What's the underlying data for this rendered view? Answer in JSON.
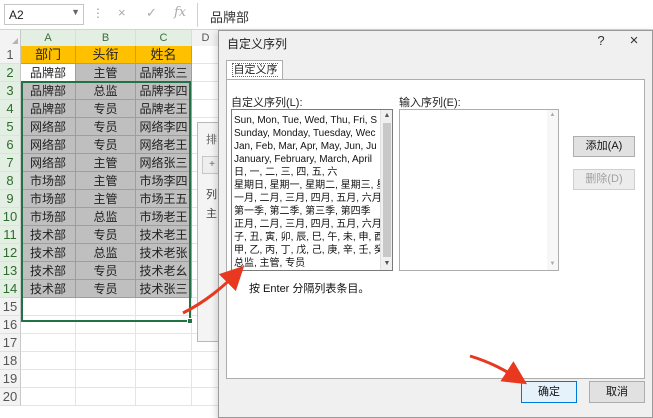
{
  "formula_bar": {
    "name_box": "A2",
    "cancel_icon": "×",
    "confirm_icon": "✓",
    "function_icon": "fx",
    "value": "品牌部"
  },
  "sheet": {
    "columns": [
      "A",
      "B",
      "C",
      "D"
    ],
    "rows": [
      "1",
      "2",
      "3",
      "4",
      "5",
      "6",
      "7",
      "8",
      "9",
      "10",
      "11",
      "12",
      "13",
      "14",
      "15",
      "16",
      "17",
      "18",
      "19",
      "20"
    ],
    "header_row": [
      "部门",
      "头衔",
      "姓名"
    ],
    "data": [
      [
        "品牌部",
        "主管",
        "品牌张三"
      ],
      [
        "品牌部",
        "总监",
        "品牌李四"
      ],
      [
        "品牌部",
        "专员",
        "品牌老王"
      ],
      [
        "网络部",
        "专员",
        "网络李四"
      ],
      [
        "网络部",
        "专员",
        "网络老王"
      ],
      [
        "网络部",
        "主管",
        "网络张三"
      ],
      [
        "市场部",
        "主管",
        "市场李四"
      ],
      [
        "市场部",
        "主管",
        "市场王五"
      ],
      [
        "市场部",
        "总监",
        "市场老王"
      ],
      [
        "技术部",
        "专员",
        "技术老王"
      ],
      [
        "技术部",
        "总监",
        "技术老张"
      ],
      [
        "技术部",
        "专员",
        "技术老幺"
      ],
      [
        "技术部",
        "专员",
        "技术张三"
      ]
    ],
    "header_color": "#ffc000",
    "body_color": "#bfbfbf",
    "selection_color": "#217346"
  },
  "sort_dialog": {
    "title": "排",
    "button": "+",
    "column_label": "列",
    "value_label": "主"
  },
  "dialog": {
    "title": "自定义序列",
    "help": "?",
    "close": "×",
    "tab": "自定义序列",
    "lists_label": "自定义序列(L):",
    "entries_label": "输入序列(E):",
    "lists": [
      "Sun, Mon, Tue, Wed, Thu, Fri, S",
      "Sunday, Monday, Tuesday, Wec",
      "Jan, Feb, Mar, Apr, May, Jun, Ju",
      "January, February, March, April",
      "日, 一, 二, 三, 四, 五, 六",
      "星期日, 星期一, 星期二, 星期三, 星",
      "一月, 二月, 三月, 四月, 五月, 六月,",
      "第一季, 第二季, 第三季, 第四季",
      "正月, 二月, 三月, 四月, 五月, 六月,",
      "子, 丑, 寅, 卯, 辰, 巳, 午, 未, 申, 酉",
      "甲, 乙, 丙, 丁, 戊, 己, 庚, 辛, 壬, 癸",
      "总监, 主管, 专员"
    ],
    "add_button": "添加(A)",
    "delete_button": "删除(D)",
    "hint": "按 Enter 分隔列表条目。",
    "ok_button": "确定",
    "cancel_button": "取消",
    "accent_color": "#0078d7",
    "arrow_color": "#e8381f"
  }
}
